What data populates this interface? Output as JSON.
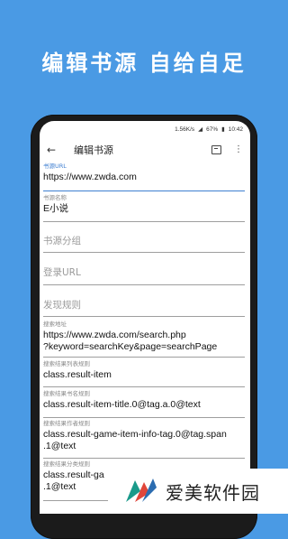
{
  "headline": "编辑书源  自给自足",
  "status": {
    "speed": "1.56K/s",
    "battery": "67%",
    "time": "10:42"
  },
  "toolbar": {
    "title": "编辑书源",
    "back_icon": "arrow-left-icon",
    "save_icon": "save-icon",
    "more_icon": "more-vert-icon"
  },
  "form": {
    "source_url": {
      "label": "书源URL",
      "value": "https://www.zwda.com"
    },
    "source_name": {
      "label": "书源名称",
      "value": "E小说"
    },
    "source_group": {
      "placeholder": "书源分组"
    },
    "login_url": {
      "placeholder": "登录URL"
    },
    "find_rule": {
      "placeholder": "发现规则"
    },
    "search_url": {
      "label": "搜索地址",
      "line1": "https://www.zwda.com/search.php",
      "line2": "?keyword=searchKey&page=searchPage"
    },
    "search_list": {
      "label": "搜索结果列表规则",
      "value": "class.result-item"
    },
    "book_name": {
      "label": "搜索结果书名规则",
      "value": "class.result-item-title.0@tag.a.0@text"
    },
    "author": {
      "label": "搜索结果作者规则",
      "line1": "class.result-game-item-info-tag.0@tag.span",
      "line2": ".1@text"
    },
    "kind": {
      "label": "搜索结果分类规则",
      "line1": "class.result-ga",
      "line2": ".1@text"
    }
  },
  "watermark": {
    "text": "爱美软件园"
  },
  "colors": {
    "background": "#4a9ae4",
    "accent": "#3f7fd1"
  }
}
